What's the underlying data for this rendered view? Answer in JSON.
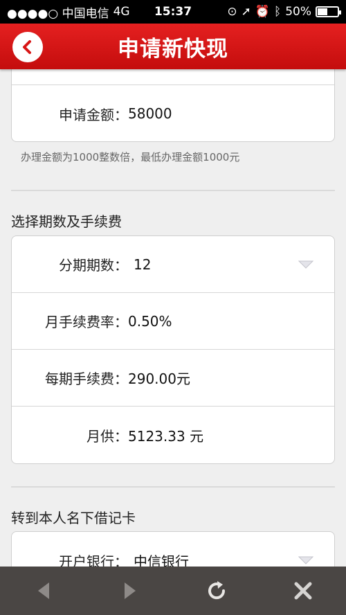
{
  "status": {
    "carrier": "●●●●○ 中国电信",
    "network": "4G",
    "time": "15:37",
    "battery": "50%",
    "battery_level": 0.5
  },
  "header": {
    "title": "申请新快现"
  },
  "amount_section": {
    "label": "申请金额：",
    "value": "58000",
    "note": "办理金额为1000整数倍，最低办理金额1000元"
  },
  "fee_section": {
    "title": "选择期数及手续费",
    "rows": [
      {
        "label": "分期期数：",
        "value": "12"
      },
      {
        "label": "月手续费率：",
        "value": "0.50%"
      },
      {
        "label": "每期手续费：",
        "value": "290.00元"
      },
      {
        "label": "月供：",
        "value": "5123.33 元"
      }
    ]
  },
  "card_section": {
    "title": "转到本人名下借记卡",
    "rows": [
      {
        "label": "开户银行：",
        "value": "中信银行"
      }
    ]
  },
  "colors": {
    "header_red": "#d81515",
    "toolbar": "#4a4644",
    "background": "#efefef"
  },
  "icons": {
    "back": "back-arrow-icon",
    "prev": "left-arrow-icon",
    "next": "right-arrow-icon",
    "refresh": "refresh-icon",
    "close": "close-icon"
  }
}
